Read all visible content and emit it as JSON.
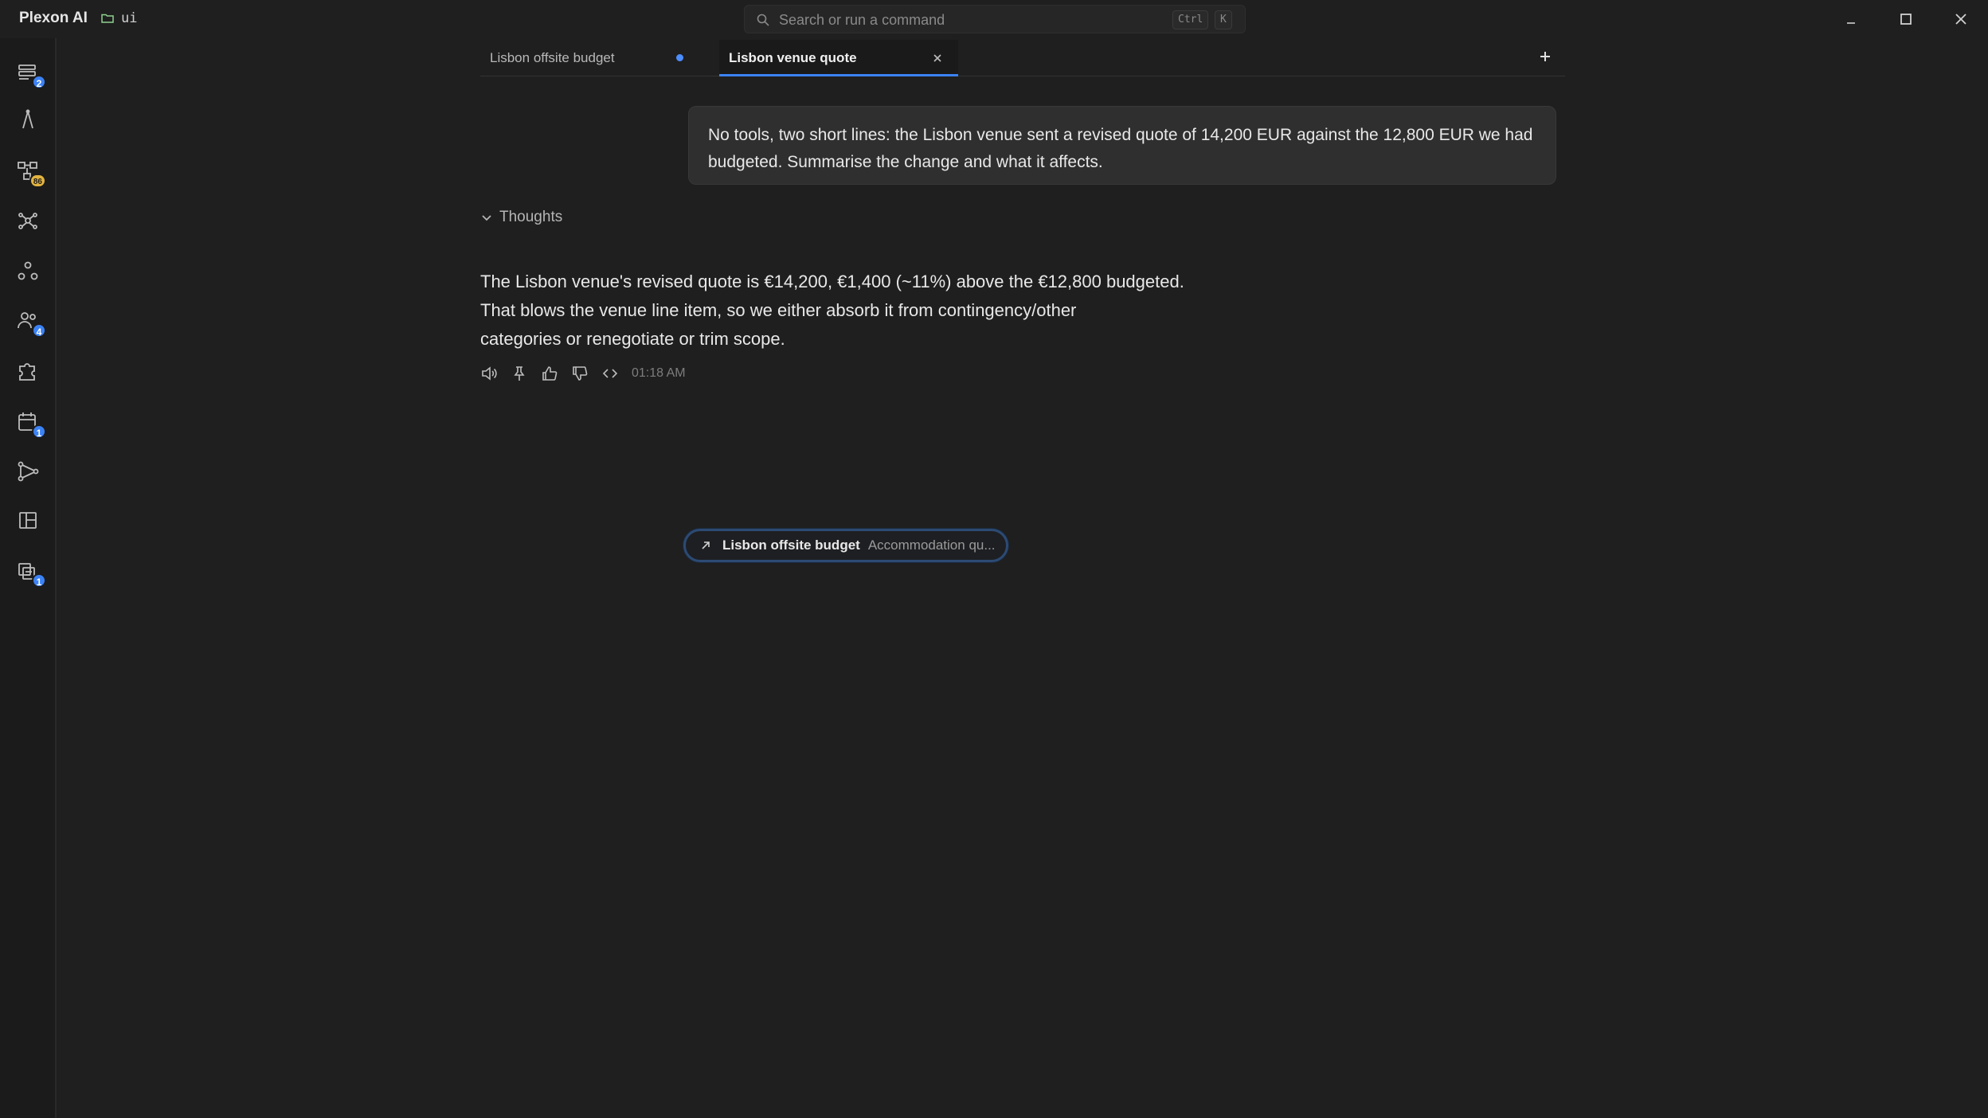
{
  "app": {
    "name": "Plexon AI",
    "workspace": "ui"
  },
  "search": {
    "placeholder": "Search or run a command",
    "shortcut_mod": "Ctrl",
    "shortcut_key": "K"
  },
  "sidebar": {
    "items": [
      {
        "icon": "conversations-icon",
        "badge": "2"
      },
      {
        "icon": "compass-icon",
        "badge": ""
      },
      {
        "icon": "workflow-icon",
        "badge": "86"
      },
      {
        "icon": "network-icon",
        "badge": ""
      },
      {
        "icon": "nodes-icon",
        "badge": ""
      },
      {
        "icon": "people-icon",
        "badge": "4"
      },
      {
        "icon": "puzzle-icon",
        "badge": ""
      },
      {
        "icon": "calendar-icon",
        "badge": "1"
      },
      {
        "icon": "branch-icon",
        "badge": ""
      },
      {
        "icon": "layout-icon",
        "badge": ""
      },
      {
        "icon": "notes-icon",
        "badge": "1"
      }
    ]
  },
  "tabs": [
    {
      "label": "Lisbon offsite budget",
      "unsaved": true,
      "active": false
    },
    {
      "label": "Lisbon venue quote",
      "unsaved": false,
      "active": true
    }
  ],
  "chat": {
    "user_message": "No tools, two short lines: the Lisbon venue sent a revised quote of 14,200 EUR against the 12,800 EUR we had budgeted. Summarise the change and what it affects.",
    "thoughts_label": "Thoughts",
    "assistant_lines": [
      "The Lisbon venue's revised quote is €14,200, €1,400 (~11%) above the €12,800 budgeted.",
      "That blows the venue line item, so we either absorb it from contingency/other",
      "categories or renegotiate or trim scope."
    ],
    "timestamp": "01:18 AM"
  },
  "chip": {
    "title": "Lisbon offsite budget",
    "subtitle": "Accommodation qu..."
  },
  "colors": {
    "accent": "#3b82f6",
    "background": "#1f1f1f",
    "badge_yellow": "#e2b340"
  }
}
